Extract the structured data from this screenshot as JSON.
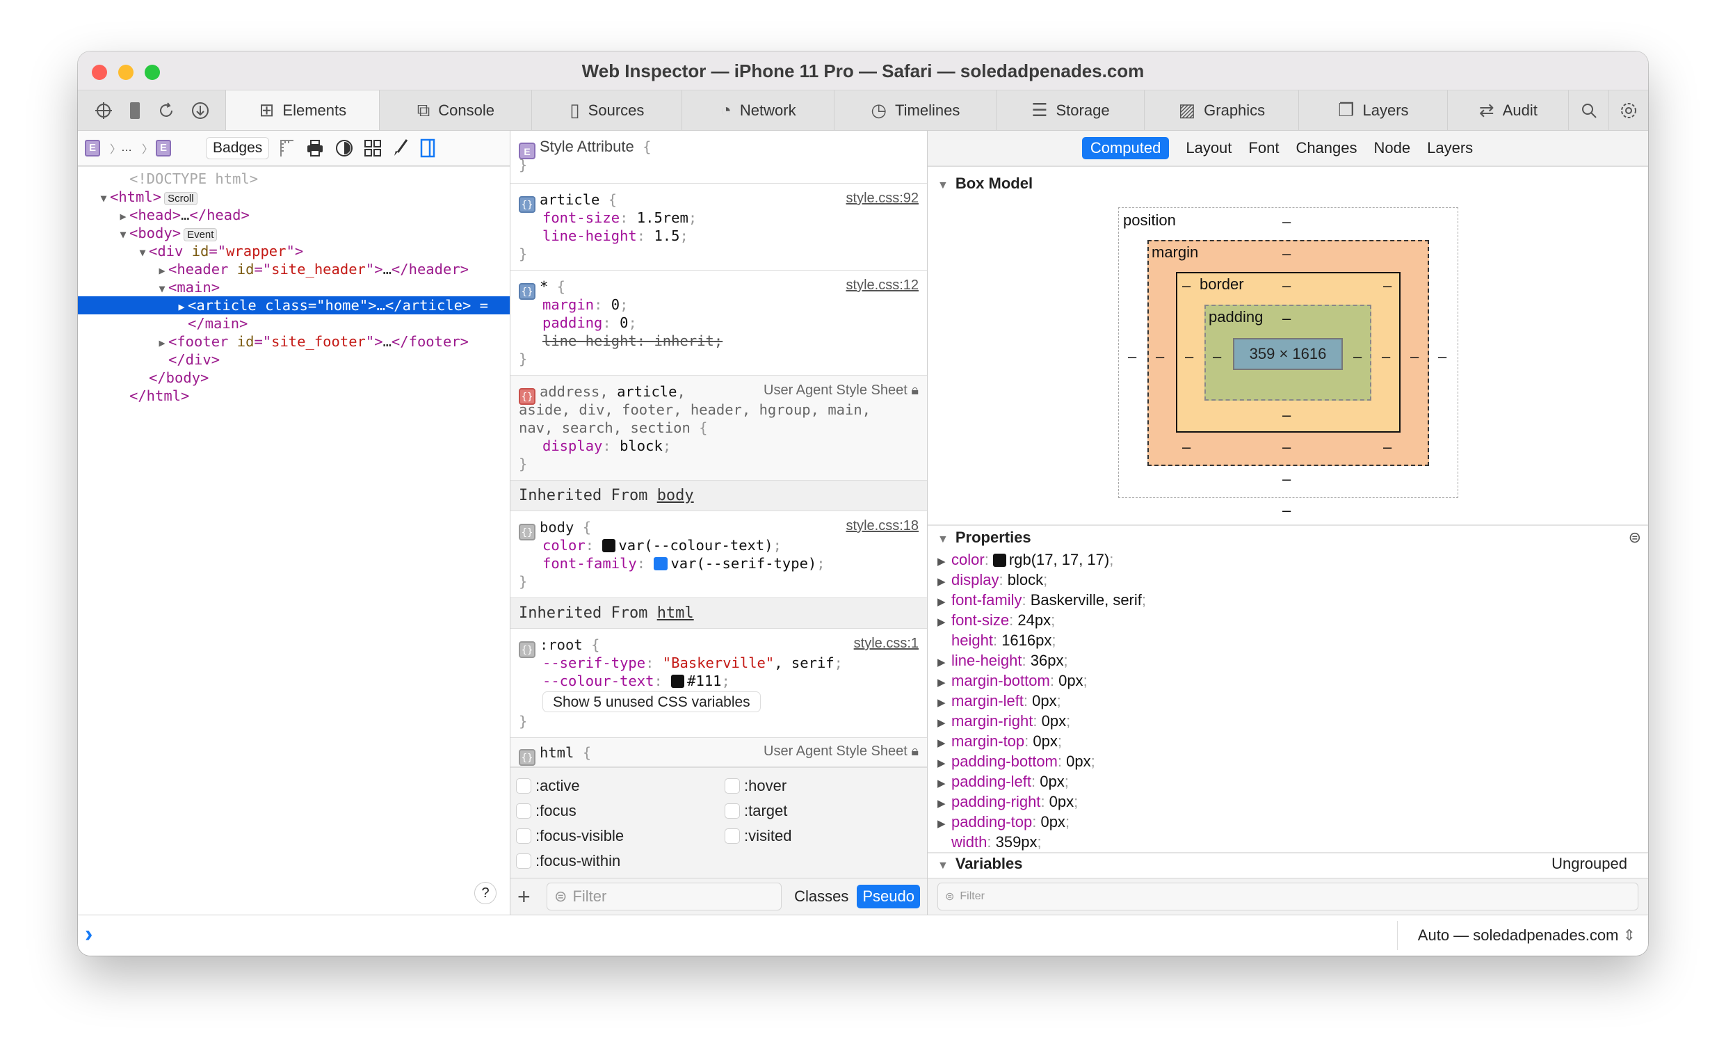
{
  "window": {
    "title": "Web Inspector — iPhone 11 Pro — Safari — soledadpenades.com",
    "traffic_lights": [
      "#fe5f57",
      "#febc2e",
      "#28c840"
    ]
  },
  "toolbar": {
    "left_icons": [
      "crosshair-icon",
      "device-icon",
      "reload-icon",
      "download-icon"
    ],
    "tabs": [
      {
        "label": "Elements",
        "icon": "elements-icon",
        "selected": true
      },
      {
        "label": "Console",
        "icon": "console-icon"
      },
      {
        "label": "Sources",
        "icon": "sources-icon"
      },
      {
        "label": "Network",
        "icon": "network-icon"
      },
      {
        "label": "Timelines",
        "icon": "timelines-icon"
      },
      {
        "label": "Storage",
        "icon": "storage-icon"
      },
      {
        "label": "Graphics",
        "icon": "graphics-icon"
      },
      {
        "label": "Layers",
        "icon": "layers-icon"
      },
      {
        "label": "Audit",
        "icon": "audit-icon"
      }
    ],
    "right_icons": [
      "search-icon",
      "gear-icon"
    ]
  },
  "elements": {
    "breadcrumb": [
      "E",
      "…",
      "E"
    ],
    "badges_label": "Badges",
    "dom_tree": [
      {
        "indent": 1,
        "arrow": "",
        "parts": [
          {
            "t": "<!DOCTYPE html>",
            "c": "doc"
          }
        ]
      },
      {
        "indent": 0,
        "arrow": "open",
        "parts": [
          {
            "t": "<html>",
            "c": "tag"
          },
          {
            "t": "Scroll",
            "c": "badge"
          }
        ]
      },
      {
        "indent": 1,
        "arrow": "closed",
        "parts": [
          {
            "t": "<head>",
            "c": "tag"
          },
          {
            "t": "…",
            "c": "text"
          },
          {
            "t": "</head>",
            "c": "tag"
          }
        ]
      },
      {
        "indent": 1,
        "arrow": "open",
        "parts": [
          {
            "t": "<body>",
            "c": "tag"
          },
          {
            "t": "Event",
            "c": "badge"
          }
        ]
      },
      {
        "indent": 2,
        "arrow": "open",
        "parts": [
          {
            "t": "<div ",
            "c": "tag"
          },
          {
            "t": "id",
            "c": "attr"
          },
          {
            "t": "=\"",
            "c": "tag"
          },
          {
            "t": "wrapper",
            "c": "val"
          },
          {
            "t": "\">",
            "c": "tag"
          }
        ]
      },
      {
        "indent": 3,
        "arrow": "closed",
        "parts": [
          {
            "t": "<header ",
            "c": "tag"
          },
          {
            "t": "id",
            "c": "attr"
          },
          {
            "t": "=\"",
            "c": "tag"
          },
          {
            "t": "site_header",
            "c": "val"
          },
          {
            "t": "\">",
            "c": "tag"
          },
          {
            "t": "…",
            "c": "text"
          },
          {
            "t": "</header>",
            "c": "tag"
          }
        ]
      },
      {
        "indent": 3,
        "arrow": "open",
        "parts": [
          {
            "t": "<main>",
            "c": "tag"
          }
        ]
      },
      {
        "indent": 4,
        "arrow": "closed",
        "selected": true,
        "parts": [
          {
            "t": "<article ",
            "c": "tag"
          },
          {
            "t": "class",
            "c": "attr"
          },
          {
            "t": "=\"",
            "c": "tag"
          },
          {
            "t": "home",
            "c": "val"
          },
          {
            "t": "\">",
            "c": "tag"
          },
          {
            "t": "…",
            "c": "text"
          },
          {
            "t": "</article>",
            "c": "tag"
          },
          {
            "t": " =",
            "c": "text"
          }
        ]
      },
      {
        "indent": 4,
        "arrow": "",
        "parts": [
          {
            "t": "</main>",
            "c": "tag"
          }
        ]
      },
      {
        "indent": 3,
        "arrow": "closed",
        "parts": [
          {
            "t": "<footer ",
            "c": "tag"
          },
          {
            "t": "id",
            "c": "attr"
          },
          {
            "t": "=\"",
            "c": "tag"
          },
          {
            "t": "site_footer",
            "c": "val"
          },
          {
            "t": "\">",
            "c": "tag"
          },
          {
            "t": "…",
            "c": "text"
          },
          {
            "t": "</footer>",
            "c": "tag"
          }
        ]
      },
      {
        "indent": 3,
        "arrow": "",
        "parts": [
          {
            "t": "</div>",
            "c": "tag"
          }
        ]
      },
      {
        "indent": 2,
        "arrow": "",
        "parts": [
          {
            "t": "</body>",
            "c": "tag"
          }
        ]
      },
      {
        "indent": 1,
        "arrow": "",
        "parts": [
          {
            "t": "</html>",
            "c": "tag"
          }
        ]
      }
    ],
    "help_label": "?"
  },
  "styles": {
    "style_attribute": {
      "icon": "E",
      "label": "Style Attribute",
      "open": "{",
      "close": "}"
    },
    "rules": [
      {
        "kind": "author",
        "selector": [
          {
            "t": "article",
            "m": true
          }
        ],
        "source": "style.css:92",
        "props": [
          {
            "name": "font-size",
            "value": "1.5rem"
          },
          {
            "name": "line-height",
            "value": "1.5"
          }
        ]
      },
      {
        "kind": "author",
        "selector": [
          {
            "t": "*",
            "m": true
          }
        ],
        "source": "style.css:12",
        "props": [
          {
            "name": "margin",
            "value": "0"
          },
          {
            "name": "padding",
            "value": "0"
          },
          {
            "name": "line-height",
            "value": "inherit",
            "overridden": true
          }
        ]
      },
      {
        "kind": "ua",
        "selector_lines": [
          [
            {
              "t": "address",
              "m": false
            },
            {
              "t": ", ",
              "m": false
            },
            {
              "t": "article",
              "m": true
            },
            {
              "t": ",",
              "m": false
            }
          ],
          [
            {
              "t": "aside, div, footer, header, hgroup, main,",
              "m": false
            }
          ],
          [
            {
              "t": "nav, search, section",
              "m": false
            }
          ]
        ],
        "source": "User Agent Style Sheet",
        "props": [
          {
            "name": "display",
            "value": "block"
          }
        ]
      }
    ],
    "inherited_body": {
      "prefix": "Inherited From ",
      "link": "body"
    },
    "body_rule": {
      "selector": "body",
      "source": "style.css:18",
      "props": [
        {
          "name": "color",
          "value": "var(--colour-text)",
          "swatch": "#111111"
        },
        {
          "name": "font-family",
          "value": "var(--serif-type)"
        }
      ]
    },
    "inherited_html": {
      "prefix": "Inherited From ",
      "link": "html"
    },
    "root_rule": {
      "selector": ":root",
      "source": "style.css:1",
      "props": [
        {
          "name": "--serif-type",
          "value_str": "\"Baskerville\"",
          "value": ", serif"
        },
        {
          "name": "--colour-text",
          "value": "#111",
          "swatch": "#111111"
        }
      ],
      "unused_button": "Show 5 unused CSS variables"
    },
    "html_rule": {
      "selector": "html",
      "source": "User Agent Style Sheet"
    },
    "pseudo_classes": [
      ":active",
      ":hover",
      ":focus",
      ":target",
      ":focus-visible",
      ":visited",
      ":focus-within"
    ],
    "filter_placeholder": "Filter",
    "classes_label": "Classes",
    "pseudo_label": "Pseudo"
  },
  "sidebar": {
    "tabs": [
      {
        "label": "Computed",
        "selected": true
      },
      {
        "label": "Layout"
      },
      {
        "label": "Font"
      },
      {
        "label": "Changes"
      },
      {
        "label": "Node"
      },
      {
        "label": "Layers"
      }
    ],
    "box_model": {
      "title": "Box Model",
      "position_label": "position",
      "margin_label": "margin",
      "border_label": "border",
      "padding_label": "padding",
      "content": "359 × 1616",
      "empty": "–",
      "colors": {
        "margin": "#f8c59b",
        "border": "#fbd597",
        "padding": "#bdc785",
        "content": "#82a9b8"
      }
    },
    "properties": {
      "title": "Properties",
      "items": [
        {
          "name": "color",
          "value": "rgb(17, 17, 17)",
          "expandable": true,
          "swatch": "#111111"
        },
        {
          "name": "display",
          "value": "block",
          "expandable": true
        },
        {
          "name": "font-family",
          "value": "Baskerville, serif",
          "expandable": true
        },
        {
          "name": "font-size",
          "value": "24px",
          "expandable": true
        },
        {
          "name": "height",
          "value": "1616px",
          "expandable": false
        },
        {
          "name": "line-height",
          "value": "36px",
          "expandable": true
        },
        {
          "name": "margin-bottom",
          "value": "0px",
          "expandable": true
        },
        {
          "name": "margin-left",
          "value": "0px",
          "expandable": true
        },
        {
          "name": "margin-right",
          "value": "0px",
          "expandable": true
        },
        {
          "name": "margin-top",
          "value": "0px",
          "expandable": true
        },
        {
          "name": "padding-bottom",
          "value": "0px",
          "expandable": true
        },
        {
          "name": "padding-left",
          "value": "0px",
          "expandable": true
        },
        {
          "name": "padding-right",
          "value": "0px",
          "expandable": true
        },
        {
          "name": "padding-top",
          "value": "0px",
          "expandable": true
        },
        {
          "name": "width",
          "value": "359px",
          "expandable": false
        }
      ]
    },
    "variables_title": "Variables",
    "variables_grouping": "Ungrouped",
    "filter_placeholder": "Filter"
  },
  "console": {
    "prompt": "›",
    "context": "Auto — soledadpenades.com"
  }
}
